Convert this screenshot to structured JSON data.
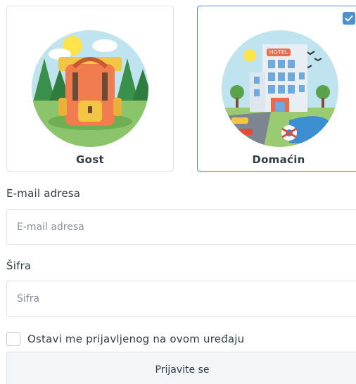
{
  "roles": {
    "guest": {
      "label": "Gost",
      "selected": false,
      "illustration_icon": "backpack-icon"
    },
    "host": {
      "label": "Domaćin",
      "selected": true,
      "illustration_icon": "hotel-icon",
      "sign_text": "HOTEL"
    }
  },
  "email": {
    "label": "E-mail adresa",
    "placeholder": "E-mail adresa",
    "value": ""
  },
  "password": {
    "label": "Šifra",
    "placeholder": "Šifra",
    "value": ""
  },
  "remember": {
    "label": "Ostavi me prijavljenog na ovom uređaju",
    "checked": false
  },
  "submit": {
    "label": "Prijavite se"
  },
  "colors": {
    "accent": "#4a90d9",
    "border": "#dfe3e8",
    "button_bg": "#f3f6f9"
  }
}
